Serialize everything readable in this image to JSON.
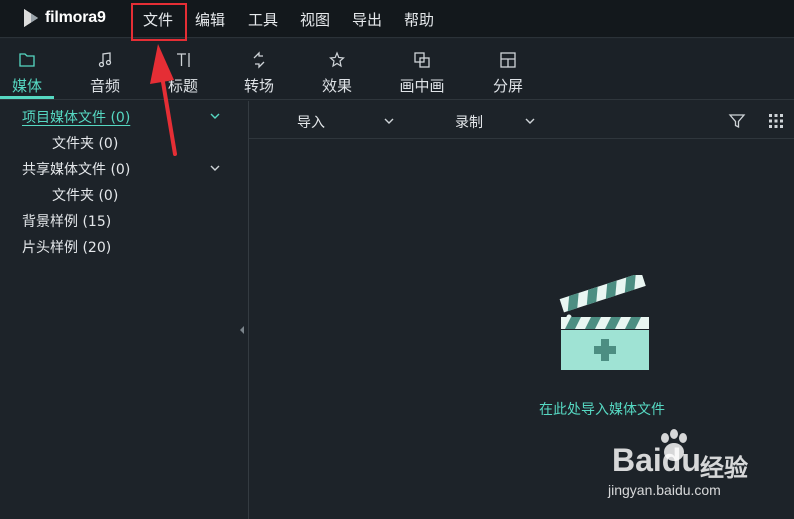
{
  "app": {
    "name": "filmora9"
  },
  "menubar": {
    "items": [
      {
        "label": "文件",
        "icon": ""
      },
      {
        "label": "编辑"
      },
      {
        "label": "工具"
      },
      {
        "label": "视图"
      },
      {
        "label": "导出"
      },
      {
        "label": "帮助"
      }
    ]
  },
  "tabs": [
    {
      "label": "媒体",
      "icon": "folder-icon",
      "active": true
    },
    {
      "label": "音频",
      "icon": "music-note-icon"
    },
    {
      "label": "标题",
      "icon": "title-text-icon"
    },
    {
      "label": "转场",
      "icon": "transition-icon"
    },
    {
      "label": "效果",
      "icon": "effects-star-icon"
    },
    {
      "label": "画中画",
      "icon": "pip-icon"
    },
    {
      "label": "分屏",
      "icon": "split-screen-icon"
    }
  ],
  "library": {
    "items": [
      {
        "label": "项目媒体文件 (0)",
        "selected": true,
        "expandable": true
      },
      {
        "label": "文件夹 (0)",
        "indent": true
      },
      {
        "label": "共享媒体文件 (0)",
        "expandable": true
      },
      {
        "label": "文件夹 (0)",
        "indent": true
      },
      {
        "label": "背景样例 (15)"
      },
      {
        "label": "片头样例 (20)"
      }
    ]
  },
  "toolbar": {
    "import_label": "导入",
    "record_label": "录制",
    "filter_icon": "filter-icon",
    "grid_icon": "grid-view-icon"
  },
  "media_area": {
    "import_hint": "在此处导入媒体文件",
    "icon": "clapperboard-add-icon"
  },
  "watermark": {
    "brand": "Baidu",
    "product": "经验",
    "url": "jingyan.baidu.com"
  },
  "colors": {
    "accent": "#56d8c2",
    "annotation_red": "#e52e35",
    "background": "#1d2329",
    "menubar": "#13181c"
  }
}
